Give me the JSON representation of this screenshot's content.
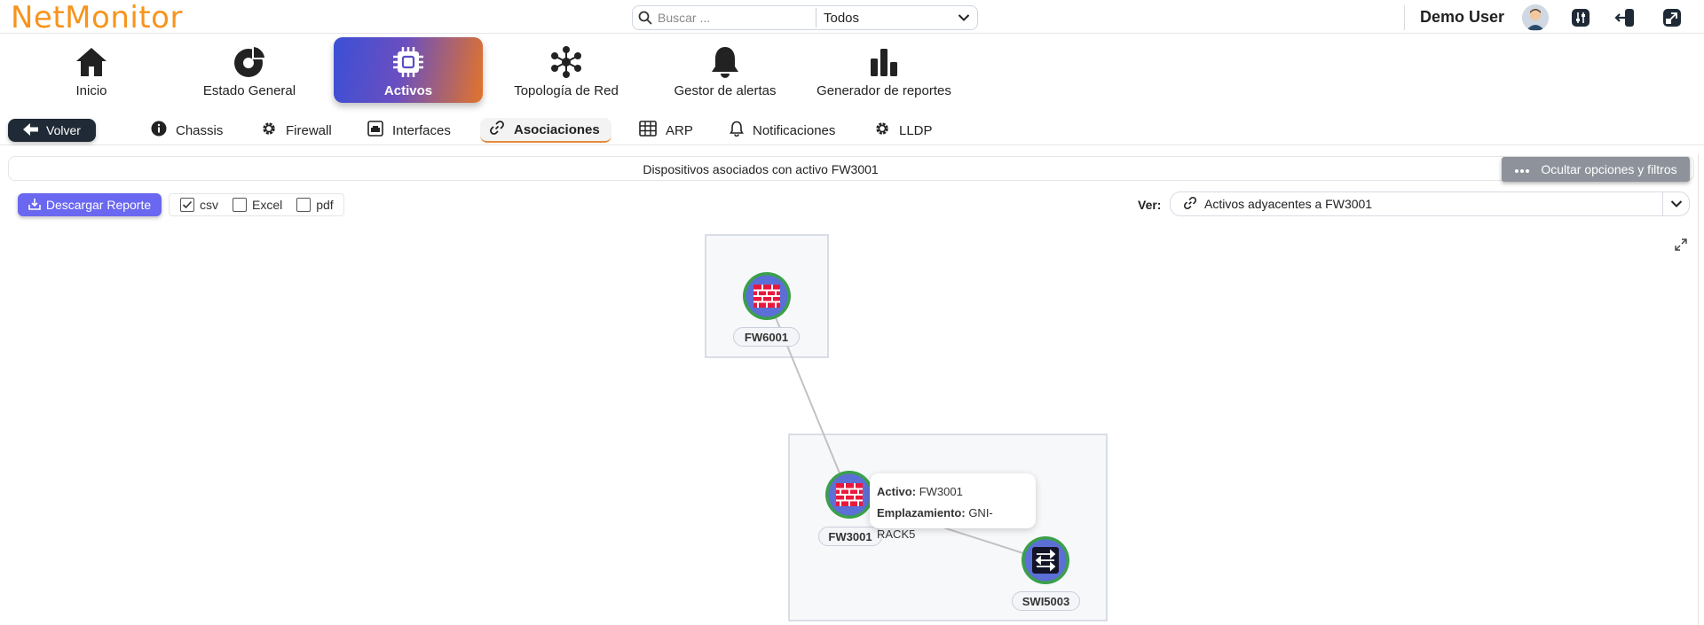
{
  "app": {
    "logo": "NetMonitor"
  },
  "search": {
    "placeholder": "Buscar ...",
    "scope": "Todos"
  },
  "user": {
    "name": "Demo User"
  },
  "main_nav": [
    {
      "label": "Inicio",
      "icon": "home-icon"
    },
    {
      "label": "Estado General",
      "icon": "pie-chart-icon"
    },
    {
      "label": "Activos",
      "icon": "chip-icon",
      "active": true
    },
    {
      "label": "Topología de Red",
      "icon": "network-icon"
    },
    {
      "label": "Gestor de alertas",
      "icon": "bell-icon"
    },
    {
      "label": "Generador de reportes",
      "icon": "bar-chart-icon"
    }
  ],
  "sub_nav": {
    "back_label": "Volver",
    "tabs": [
      {
        "label": "Chassis",
        "icon": "info-icon"
      },
      {
        "label": "Firewall",
        "icon": "gear-icon"
      },
      {
        "label": "Interfaces",
        "icon": "interfaces-icon"
      },
      {
        "label": "Asociaciones",
        "icon": "link-icon",
        "active": true
      },
      {
        "label": "ARP",
        "icon": "table-icon"
      },
      {
        "label": "Notificaciones",
        "icon": "bell-icon"
      },
      {
        "label": "LLDP",
        "icon": "gear-icon"
      }
    ]
  },
  "info": {
    "title": "Dispositivos asociados con activo FW3001",
    "hide_options_label": "Ocultar opciones y filtros"
  },
  "toolbar": {
    "download_label": "Descargar Reporte",
    "formats": [
      {
        "label": "csv",
        "checked": true
      },
      {
        "label": "Excel",
        "checked": false
      },
      {
        "label": "pdf",
        "checked": false
      }
    ],
    "view_label": "Ver:",
    "view_value": "Activos adyacentes a FW3001"
  },
  "graph": {
    "nodes": [
      {
        "id": "FW6001",
        "type": "firewall"
      },
      {
        "id": "FW3001",
        "type": "firewall"
      },
      {
        "id": "SWI5003",
        "type": "switch"
      }
    ],
    "tooltip": {
      "asset_label": "Activo:",
      "asset_value": "FW3001",
      "location_label": "Emplazamiento:",
      "location_value": "GNI-RACK5"
    }
  },
  "colors": {
    "logo": "#f7941d",
    "active_gradient_start": "#3b4fd6",
    "active_gradient_end": "#e2742a",
    "download_button": "#6a67f0",
    "firewall_node": "#e8193c",
    "node_ring": "#3aa04a"
  }
}
